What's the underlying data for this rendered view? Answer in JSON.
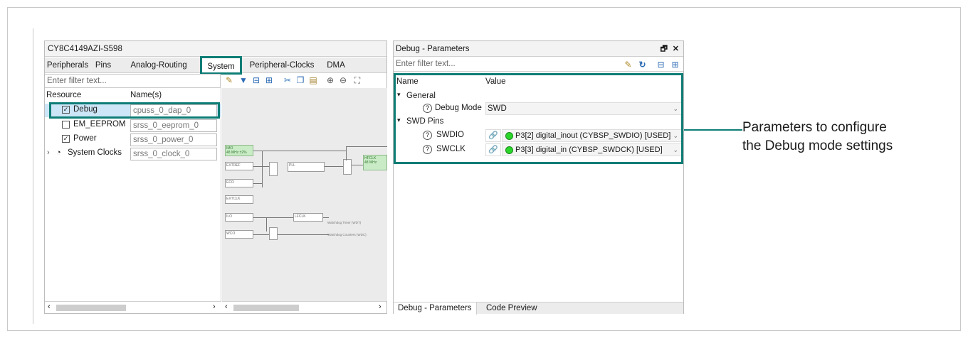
{
  "device_pane": {
    "title": "CY8C4149AZI-S598",
    "tabs": [
      "Peripherals",
      "Pins",
      "Analog-Routing",
      "System",
      "Peripheral-Clocks",
      "DMA"
    ],
    "active_tab": "System",
    "filter_placeholder": "Enter filter text...",
    "columns": {
      "resource": "Resource",
      "names": "Name(s)"
    },
    "rows": [
      {
        "label": "Debug",
        "checked": true,
        "value": "cpuss_0_dap_0"
      },
      {
        "label": "EM_EEPROM",
        "checked": false,
        "value": "srss_0_eeprom_0"
      },
      {
        "label": "Power",
        "checked": true,
        "value": "srss_0_power_0"
      },
      {
        "label": "System Clocks",
        "checked": null,
        "value": "srss_0_clock_0"
      }
    ],
    "diagram": {
      "imo": "IMO",
      "imo_freq": "48 MHz ±2%",
      "extref": "EXTREF",
      "pll": "PLL",
      "hfclk": "HFCLK",
      "hfclk_freq": "48 MHz",
      "eco": "ECO",
      "extclk": "EXTCLK",
      "ilo": "ILO",
      "lfclk": "LFCLK",
      "wco": "WCO",
      "wdt_note": "Watchdog Timer (WDT)",
      "wdc_note": "Watchdog Counters (WDC)"
    }
  },
  "debug_pane": {
    "title": "Debug - Parameters",
    "filter_placeholder": "Enter filter text...",
    "columns": {
      "name": "Name",
      "value": "Value"
    },
    "groups": [
      {
        "label": "General"
      },
      {
        "label": "SWD Pins"
      }
    ],
    "params": {
      "debug_mode": {
        "label": "Debug Mode",
        "value": "SWD"
      },
      "swdio": {
        "label": "SWDIO",
        "value": "P3[2] digital_inout (CYBSP_SWDIO) [USED]"
      },
      "swclk": {
        "label": "SWCLK",
        "value": "P3[3] digital_in (CYBSP_SWDCK) [USED]"
      }
    },
    "bottom_tabs": [
      "Debug - Parameters",
      "Code Preview"
    ],
    "active_bottom_tab": "Debug - Parameters"
  },
  "callout": {
    "line1": "Parameters to configure",
    "line2": "the Debug mode settings"
  },
  "colors": {
    "highlight": "#0e7d76",
    "pin_status": "#2bd62b"
  }
}
